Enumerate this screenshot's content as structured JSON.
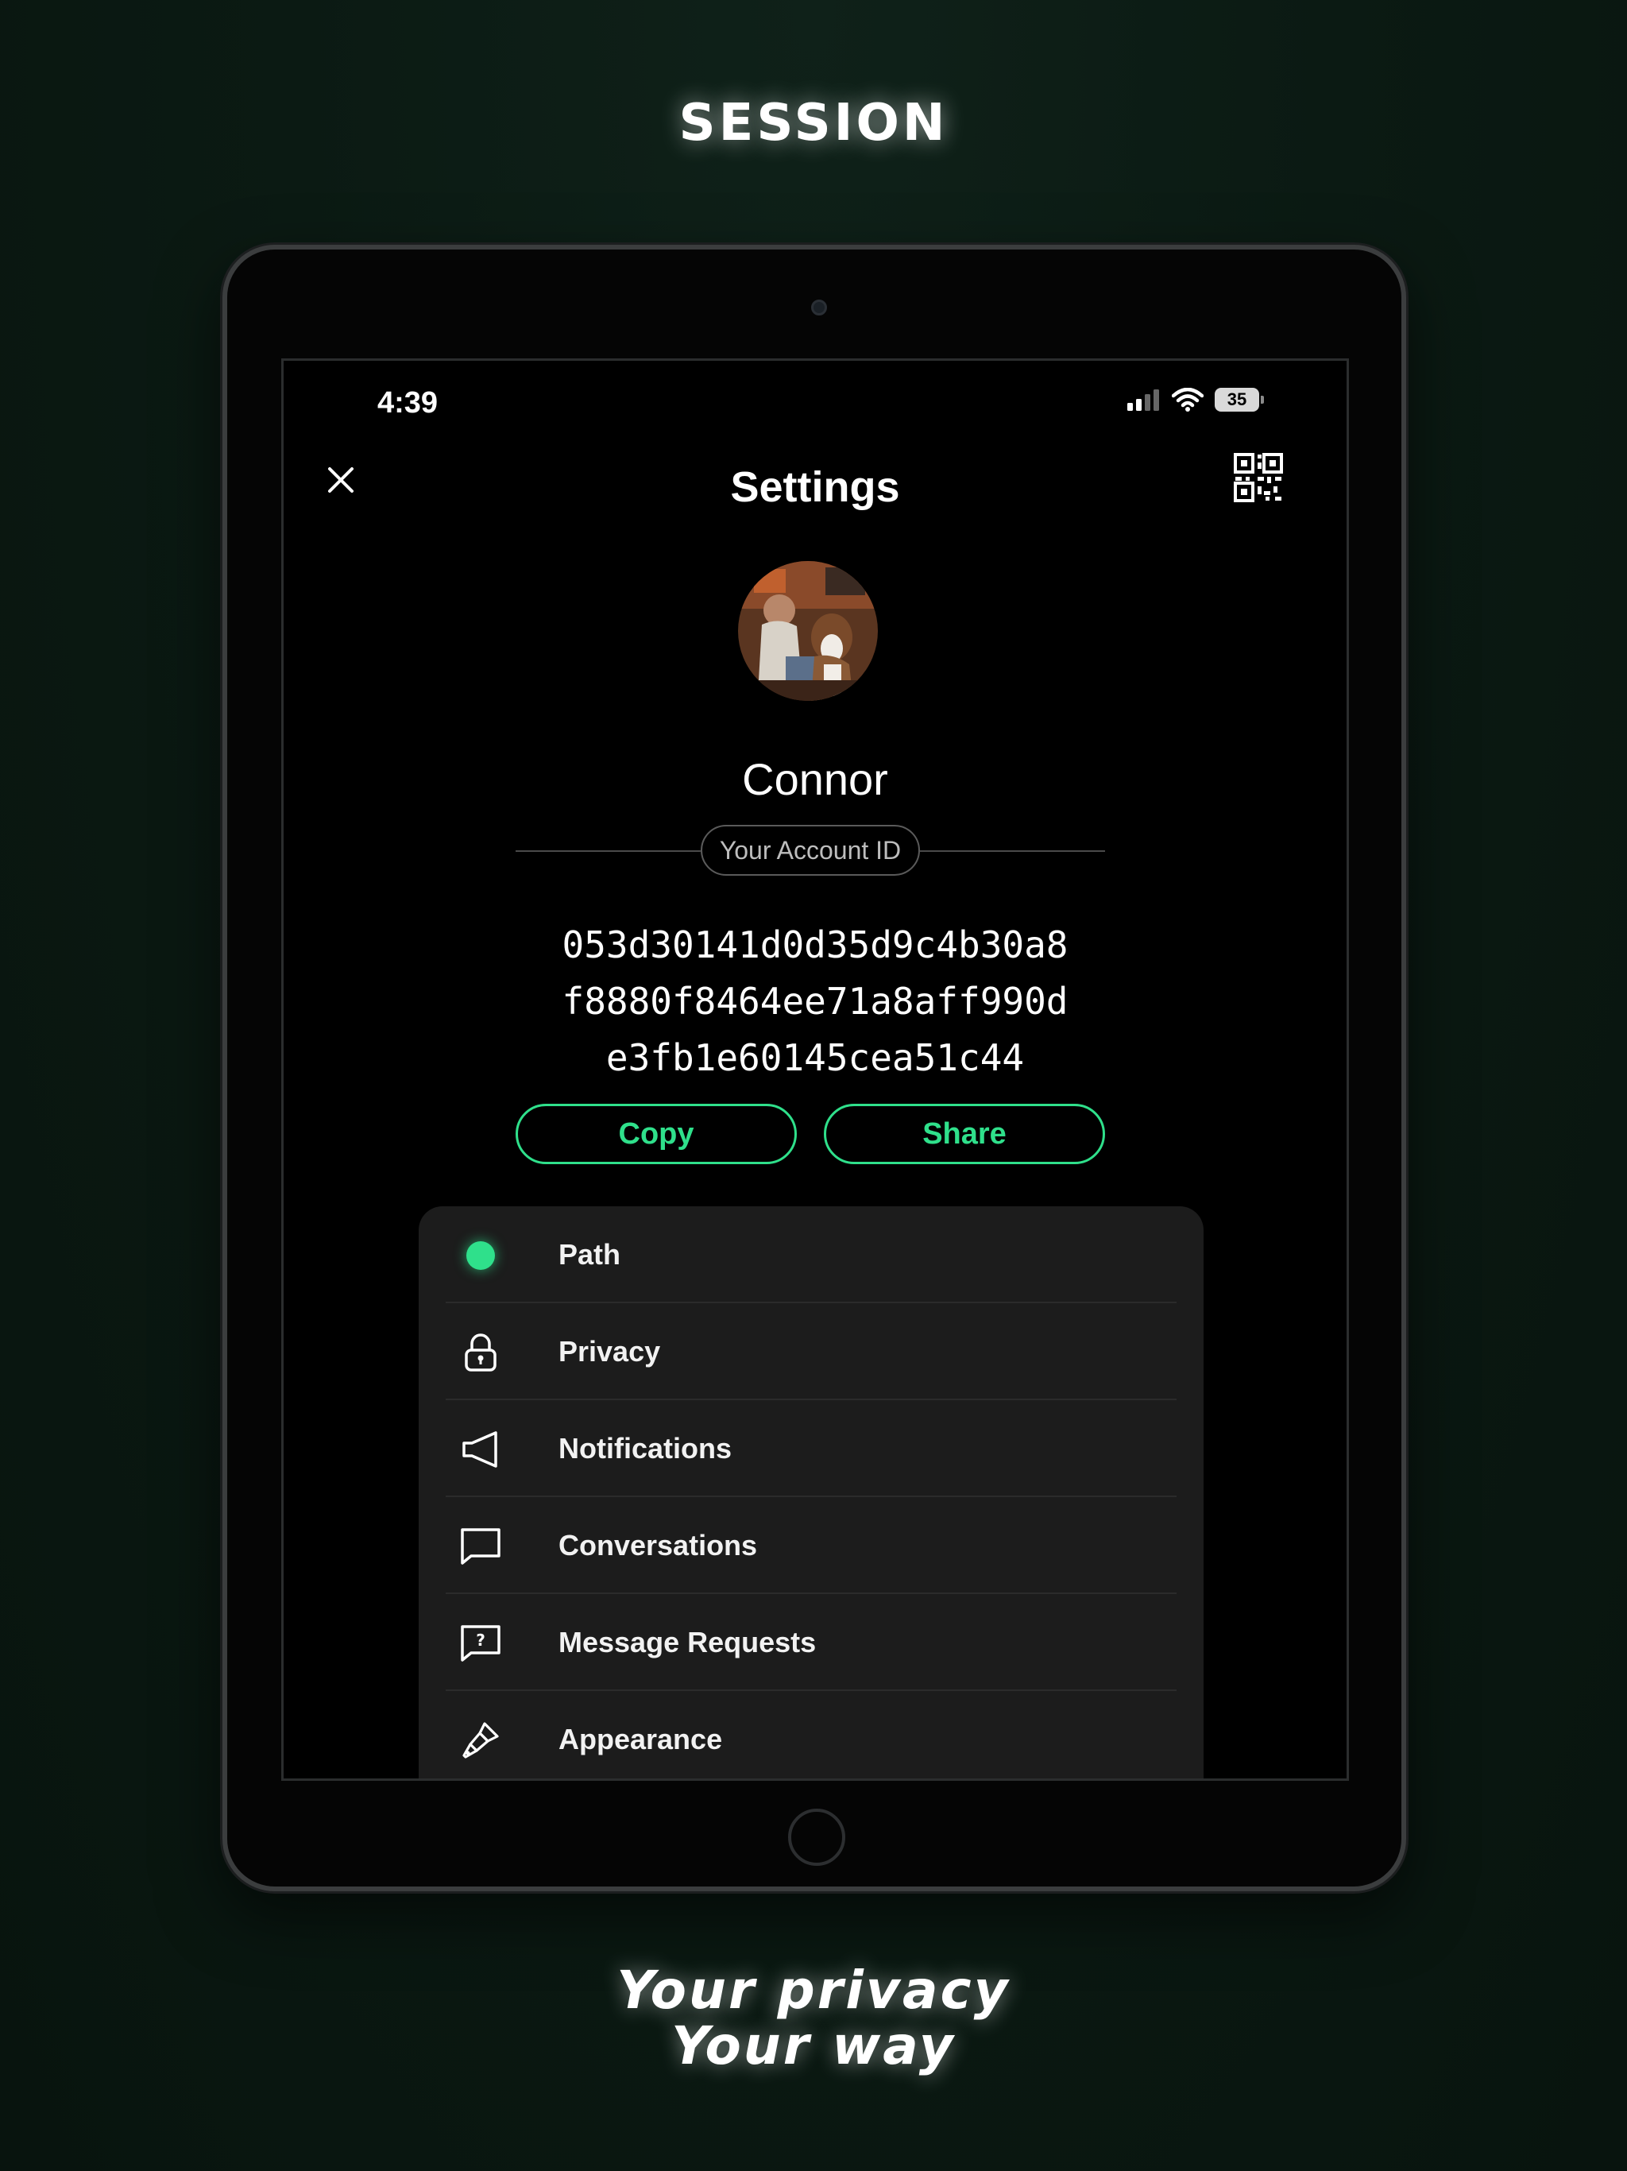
{
  "brand": "SESSION",
  "tagline": [
    "Your privacy",
    "Your way"
  ],
  "status_bar": {
    "time": "4:39",
    "battery": "35"
  },
  "nav": {
    "title": "Settings"
  },
  "profile": {
    "name": "Connor",
    "account_id_label": "Your Account ID",
    "account_id_lines": [
      "053d30141d0d35d9c4b30a8",
      "f8880f8464ee71a8aff990d",
      "e3fb1e60145cea51c44"
    ]
  },
  "buttons": {
    "copy": "Copy",
    "share": "Share"
  },
  "settings_items": [
    {
      "label": "Path",
      "icon": "path-status-dot"
    },
    {
      "label": "Privacy",
      "icon": "lock-icon"
    },
    {
      "label": "Notifications",
      "icon": "megaphone-icon"
    },
    {
      "label": "Conversations",
      "icon": "chat-bubble-icon"
    },
    {
      "label": "Message Requests",
      "icon": "question-bubble-icon"
    },
    {
      "label": "Appearance",
      "icon": "paintbrush-icon"
    }
  ],
  "colors": {
    "accent": "#2fe08b",
    "background": "#0b1a13",
    "card": "#1c1c1c"
  }
}
